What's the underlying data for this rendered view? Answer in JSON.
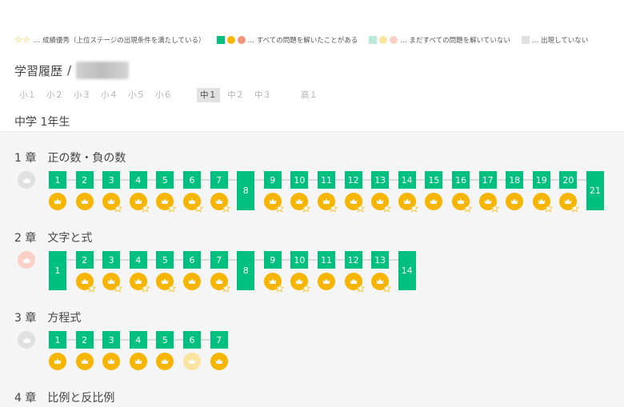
{
  "legend": {
    "excellent_text": "… 成績優秀（上位ステージの出現条件を満たしている）",
    "solved_all_text": "… すべての問題を解いたことがある",
    "not_solved_text": "… まだすべての問題を解いていない",
    "not_shown_text": "… 出現していない"
  },
  "breadcrumb": {
    "title": "学習履歴",
    "separator": "/"
  },
  "grades": [
    "小１",
    "小２",
    "小３",
    "小４",
    "小５",
    "小６",
    "中１",
    "中２",
    "中３",
    "高１"
  ],
  "active_grade": "中１",
  "section_title": "中学 1年生",
  "colors": {
    "green": "#00c07f",
    "gold": "#f7b500",
    "salmon": "#f2947a",
    "pale_green": "#b9ead7",
    "pale_gold": "#fbe3a0",
    "pale_pink": "#f9cfc6",
    "gray": "#e0e0e0",
    "star": "#f5b800"
  },
  "chapters": [
    {
      "num": "1 章",
      "name": "正の数・負の数",
      "crown_state": "gray",
      "stages": [
        {
          "label": "1",
          "medal": "gold",
          "star": false
        },
        {
          "label": "2",
          "medal": "gold",
          "star": false
        },
        {
          "label": "3",
          "medal": "gold",
          "star": true
        },
        {
          "label": "4",
          "medal": "gold",
          "star": true
        },
        {
          "label": "5",
          "medal": "gold",
          "star": true
        },
        {
          "label": "6",
          "medal": "gold",
          "star": true
        },
        {
          "label": "7",
          "medal": "gold",
          "star": true
        },
        {
          "label": "8",
          "tall": true
        },
        {
          "label": "9",
          "medal": "gold",
          "star": true
        },
        {
          "label": "10",
          "medal": "gold",
          "star": true
        },
        {
          "label": "11",
          "medal": "gold",
          "star": true
        },
        {
          "label": "12",
          "medal": "gold",
          "star": true
        },
        {
          "label": "13",
          "medal": "gold",
          "star": true
        },
        {
          "label": "14",
          "medal": "gold",
          "star": true
        },
        {
          "label": "15",
          "medal": "gold",
          "star": false
        },
        {
          "label": "16",
          "medal": "gold",
          "star": true
        },
        {
          "label": "17",
          "medal": "gold",
          "star": true
        },
        {
          "label": "18",
          "medal": "gold",
          "star": false
        },
        {
          "label": "19",
          "medal": "gold",
          "star": true
        },
        {
          "label": "20",
          "medal": "gold",
          "star": true
        },
        {
          "label": "21",
          "tall": true
        }
      ]
    },
    {
      "num": "2 章",
      "name": "文字と式",
      "crown_state": "pink",
      "stages": [
        {
          "label": "1",
          "tall": true
        },
        {
          "label": "2",
          "medal": "gold",
          "star": true
        },
        {
          "label": "3",
          "medal": "gold",
          "star": true
        },
        {
          "label": "4",
          "medal": "gold",
          "star": true
        },
        {
          "label": "5",
          "medal": "gold",
          "star": true
        },
        {
          "label": "6",
          "medal": "gold",
          "star": false
        },
        {
          "label": "7",
          "medal": "gold",
          "star": true
        },
        {
          "label": "8",
          "tall": true
        },
        {
          "label": "9",
          "medal": "gold",
          "star": true
        },
        {
          "label": "10",
          "medal": "gold",
          "star": true
        },
        {
          "label": "11",
          "medal": "gold",
          "star": false
        },
        {
          "label": "12",
          "medal": "gold",
          "star": true
        },
        {
          "label": "13",
          "medal": "gold",
          "star": true
        },
        {
          "label": "14",
          "tall": true
        }
      ]
    },
    {
      "num": "3 章",
      "name": "方程式",
      "crown_state": "gray",
      "stages": [
        {
          "label": "1",
          "medal": "gold",
          "star": false
        },
        {
          "label": "2",
          "medal": "gold",
          "star": false
        },
        {
          "label": "3",
          "medal": "gold",
          "star": false
        },
        {
          "label": "4",
          "medal": "gold",
          "star": false
        },
        {
          "label": "5",
          "medal": "gold",
          "star": false
        },
        {
          "label": "6",
          "medal": "pale",
          "star": false
        },
        {
          "label": "7",
          "medal": "gold",
          "star": false
        }
      ]
    },
    {
      "num": "4 章",
      "name": "比例と反比例",
      "crown_state": "none",
      "stages": []
    }
  ]
}
